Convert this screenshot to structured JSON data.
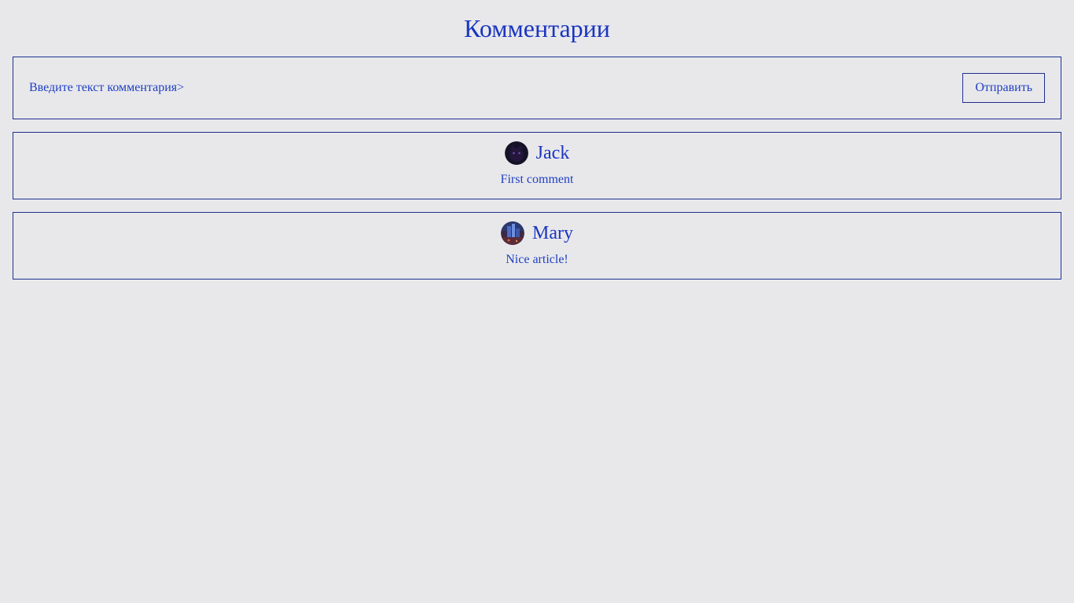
{
  "page": {
    "title": "Комментарии"
  },
  "compose": {
    "placeholder": "Введите текст комментария>",
    "value": "",
    "submit_label": "Отправить"
  },
  "comments": [
    {
      "author": "Jack",
      "text": "First comment",
      "avatar_icon": "dark-cat-avatar"
    },
    {
      "author": "Mary",
      "text": "Nice article!",
      "avatar_icon": "city-night-avatar"
    }
  ],
  "colors": {
    "background": "#e8e8eb",
    "text": "#1f3fc2",
    "border": "#1e2f8f"
  }
}
